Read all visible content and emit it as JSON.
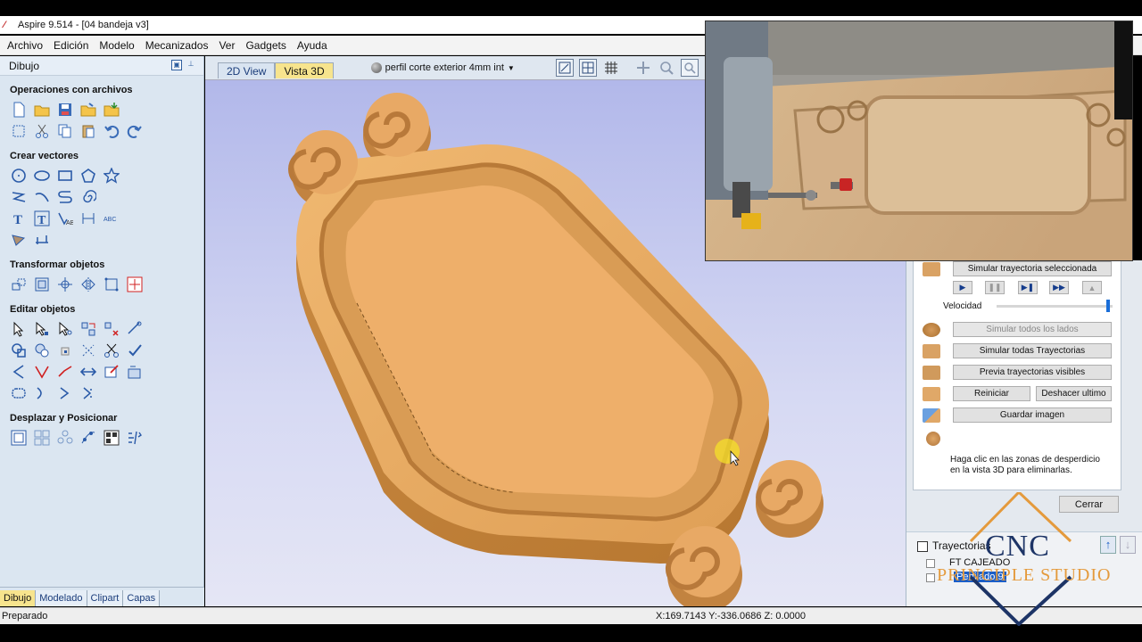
{
  "window": {
    "title": "Aspire 9.514 - [04 bandeja v3]"
  },
  "menu": [
    "Archivo",
    "Edición",
    "Modelo",
    "Mecanizados",
    "Ver",
    "Gadgets",
    "Ayuda"
  ],
  "left_panel": {
    "header": "Dibujo",
    "sections": {
      "files": "Operaciones con archivos",
      "vectors": "Crear vectores",
      "transform": "Transformar objetos",
      "edit": "Editar objetos",
      "move": "Desplazar y Posicionar"
    },
    "tabs": [
      "Dibujo",
      "Modelado",
      "Clipart",
      "Capas"
    ]
  },
  "view_tabs": {
    "tab_2d": "2D View",
    "tab_3d": "Vista 3D",
    "toolpath": "perfil corte exterior 4mm int"
  },
  "simulation": {
    "simulate_selected": "Simular trayectoria seleccionada",
    "speed_label": "Velocidad",
    "simulate_all_sides": "Simular todos los lados",
    "simulate_all": "Simular todas Trayectorias",
    "preview_visible": "Previa trayectorias visibles",
    "reset": "Reiniciar",
    "undo_last": "Deshacer ultimo",
    "save_image": "Guardar imagen",
    "hint_line1": "Haga clic en las zonas de desperdicio",
    "hint_line2": "en la vista 3D para eliminarlas.",
    "close": "Cerrar"
  },
  "toolpaths": {
    "label": "Trayectorias",
    "items": [
      "FT CAJEADO",
      "Perfilado 9"
    ]
  },
  "status": {
    "text": "Preparado",
    "coords": "X:169.7143 Y:-336.0686 Z: 0.0000"
  },
  "watermark": {
    "brand": "CNC",
    "subtitle": "PRINCIPLE STUDIO"
  },
  "colors": {
    "wood": "#e3a45c",
    "accent_tab": "#f7e48d",
    "viewport_top": "#b2b8ea"
  }
}
